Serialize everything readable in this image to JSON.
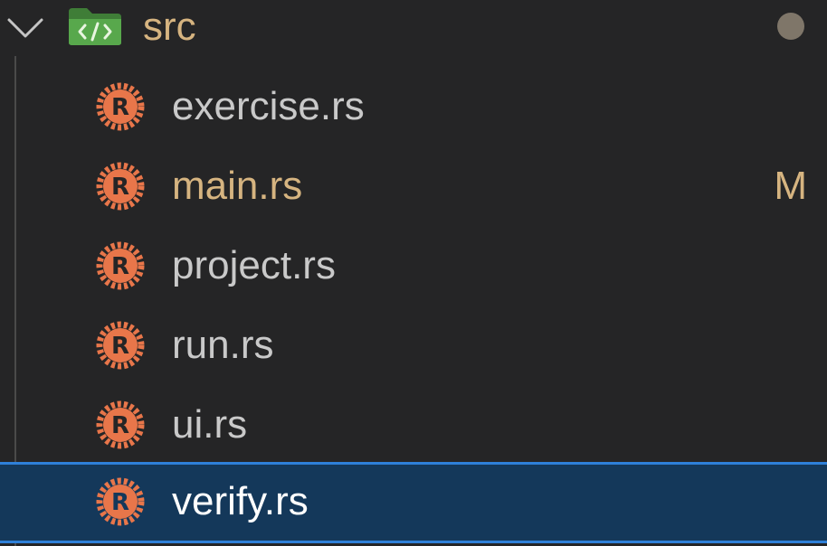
{
  "folder": {
    "name": "src",
    "expanded": true,
    "has_changes_indicator": true,
    "icon": "folder-code-icon"
  },
  "files": [
    {
      "name": "exercise.rs",
      "icon": "rust-icon",
      "status": "",
      "modified": false,
      "selected": false
    },
    {
      "name": "main.rs",
      "icon": "rust-icon",
      "status": "M",
      "modified": true,
      "selected": false
    },
    {
      "name": "project.rs",
      "icon": "rust-icon",
      "status": "",
      "modified": false,
      "selected": false
    },
    {
      "name": "run.rs",
      "icon": "rust-icon",
      "status": "",
      "modified": false,
      "selected": false
    },
    {
      "name": "ui.rs",
      "icon": "rust-icon",
      "status": "",
      "modified": false,
      "selected": false
    },
    {
      "name": "verify.rs",
      "icon": "rust-icon",
      "status": "",
      "modified": false,
      "selected": true
    }
  ],
  "colors": {
    "background": "#252526",
    "selection_background": "#14385a",
    "selection_border": "#2f80d8",
    "modified_text": "#d6b480",
    "rust_icon": "#e8764a",
    "folder_icon": "#4f9a44"
  }
}
